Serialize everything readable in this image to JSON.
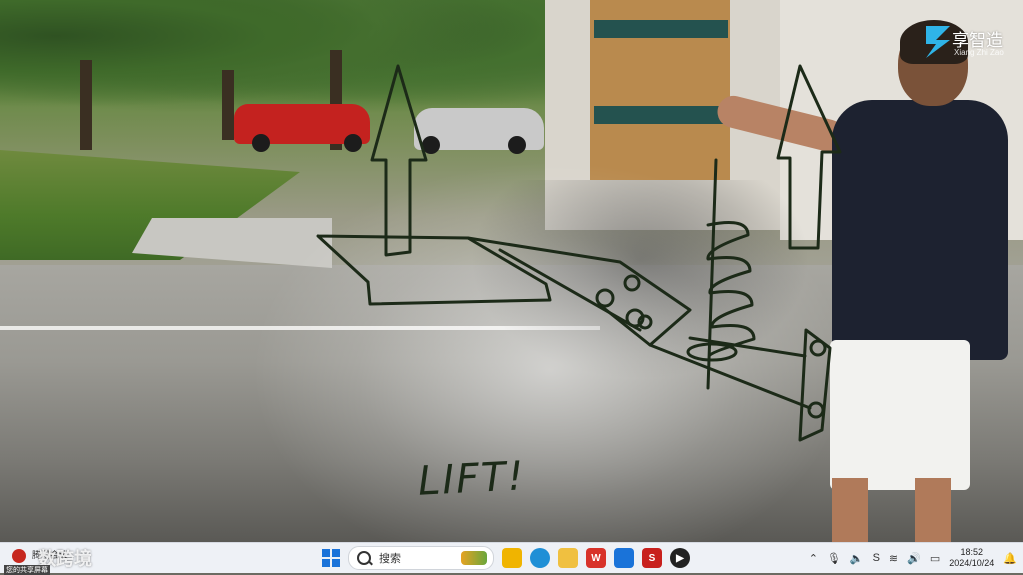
{
  "video": {
    "watermark_title": "享智造",
    "watermark_sub": "Xiang Zhi Zao",
    "sketch_text": "LIFT!"
  },
  "taskbar": {
    "meeting_label": "腾讯会议",
    "share_brand": "数跨境",
    "share_sub": "您的共享屏幕",
    "search_label": "搜索",
    "apps": [
      {
        "name": "file-explorer-icon",
        "color": "#f0b400"
      },
      {
        "name": "edge-icon",
        "color": "#1f8fd6"
      },
      {
        "name": "folder-icon",
        "color": "#f0c040"
      },
      {
        "name": "wps-icon",
        "color": "#d8322a"
      },
      {
        "name": "photos-icon",
        "color": "#1a73d9"
      },
      {
        "name": "solidworks-icon",
        "color": "#c8201d"
      },
      {
        "name": "media-player-icon",
        "color": "#222222"
      }
    ],
    "time": "18:52",
    "date": "2024/10/24"
  }
}
